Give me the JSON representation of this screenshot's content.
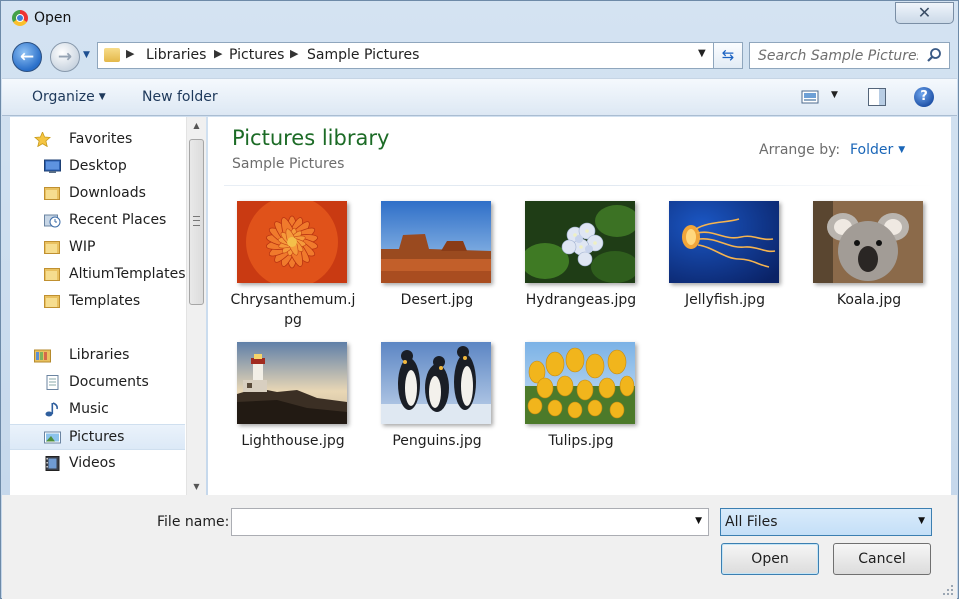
{
  "window": {
    "title": "Open",
    "close_glyph": "✕"
  },
  "address": {
    "crumbs": [
      "Libraries",
      "Pictures",
      "Sample Pictures"
    ],
    "search_placeholder": "Search Sample Pictures"
  },
  "toolbar": {
    "organize": "Organize",
    "new_folder": "New folder",
    "help": "?"
  },
  "nav": {
    "favorites": [
      {
        "label": "Favorites",
        "icon": "star-icon"
      },
      {
        "label": "Desktop",
        "icon": "desktop-icon"
      },
      {
        "label": "Downloads",
        "icon": "folder-icon"
      },
      {
        "label": "Recent Places",
        "icon": "recent-places-icon"
      },
      {
        "label": "WIP",
        "icon": "folder-icon"
      },
      {
        "label": "AltiumTemplatesL",
        "icon": "folder-icon"
      },
      {
        "label": "Templates",
        "icon": "folder-icon"
      }
    ],
    "libraries": [
      {
        "label": "Libraries",
        "icon": "libraries-icon"
      },
      {
        "label": "Documents",
        "icon": "documents-icon"
      },
      {
        "label": "Music",
        "icon": "music-icon"
      },
      {
        "label": "Pictures",
        "icon": "pictures-icon",
        "selected": true
      },
      {
        "label": "Videos",
        "icon": "videos-icon"
      }
    ]
  },
  "content": {
    "title": "Pictures library",
    "subtitle": "Sample Pictures",
    "arrange_label": "Arrange by:",
    "arrange_value": "Folder",
    "files": [
      {
        "name": "Chrysanthemum.jpg",
        "label": "Chrysanthemum.j\npg",
        "art": "chrysanthemum"
      },
      {
        "name": "Desert.jpg",
        "label": "Desert.jpg",
        "art": "desert"
      },
      {
        "name": "Hydrangeas.jpg",
        "label": "Hydrangeas.jpg",
        "art": "hydrangeas"
      },
      {
        "name": "Jellyfish.jpg",
        "label": "Jellyfish.jpg",
        "art": "jellyfish"
      },
      {
        "name": "Koala.jpg",
        "label": "Koala.jpg",
        "art": "koala"
      },
      {
        "name": "Lighthouse.jpg",
        "label": "Lighthouse.jpg",
        "art": "lighthouse"
      },
      {
        "name": "Penguins.jpg",
        "label": "Penguins.jpg",
        "art": "penguins"
      },
      {
        "name": "Tulips.jpg",
        "label": "Tulips.jpg",
        "art": "tulips"
      }
    ]
  },
  "footer": {
    "file_name_label": "File name:",
    "file_name_value": "",
    "filter_value": "All Files",
    "open_label": "Open",
    "cancel_label": "Cancel"
  }
}
